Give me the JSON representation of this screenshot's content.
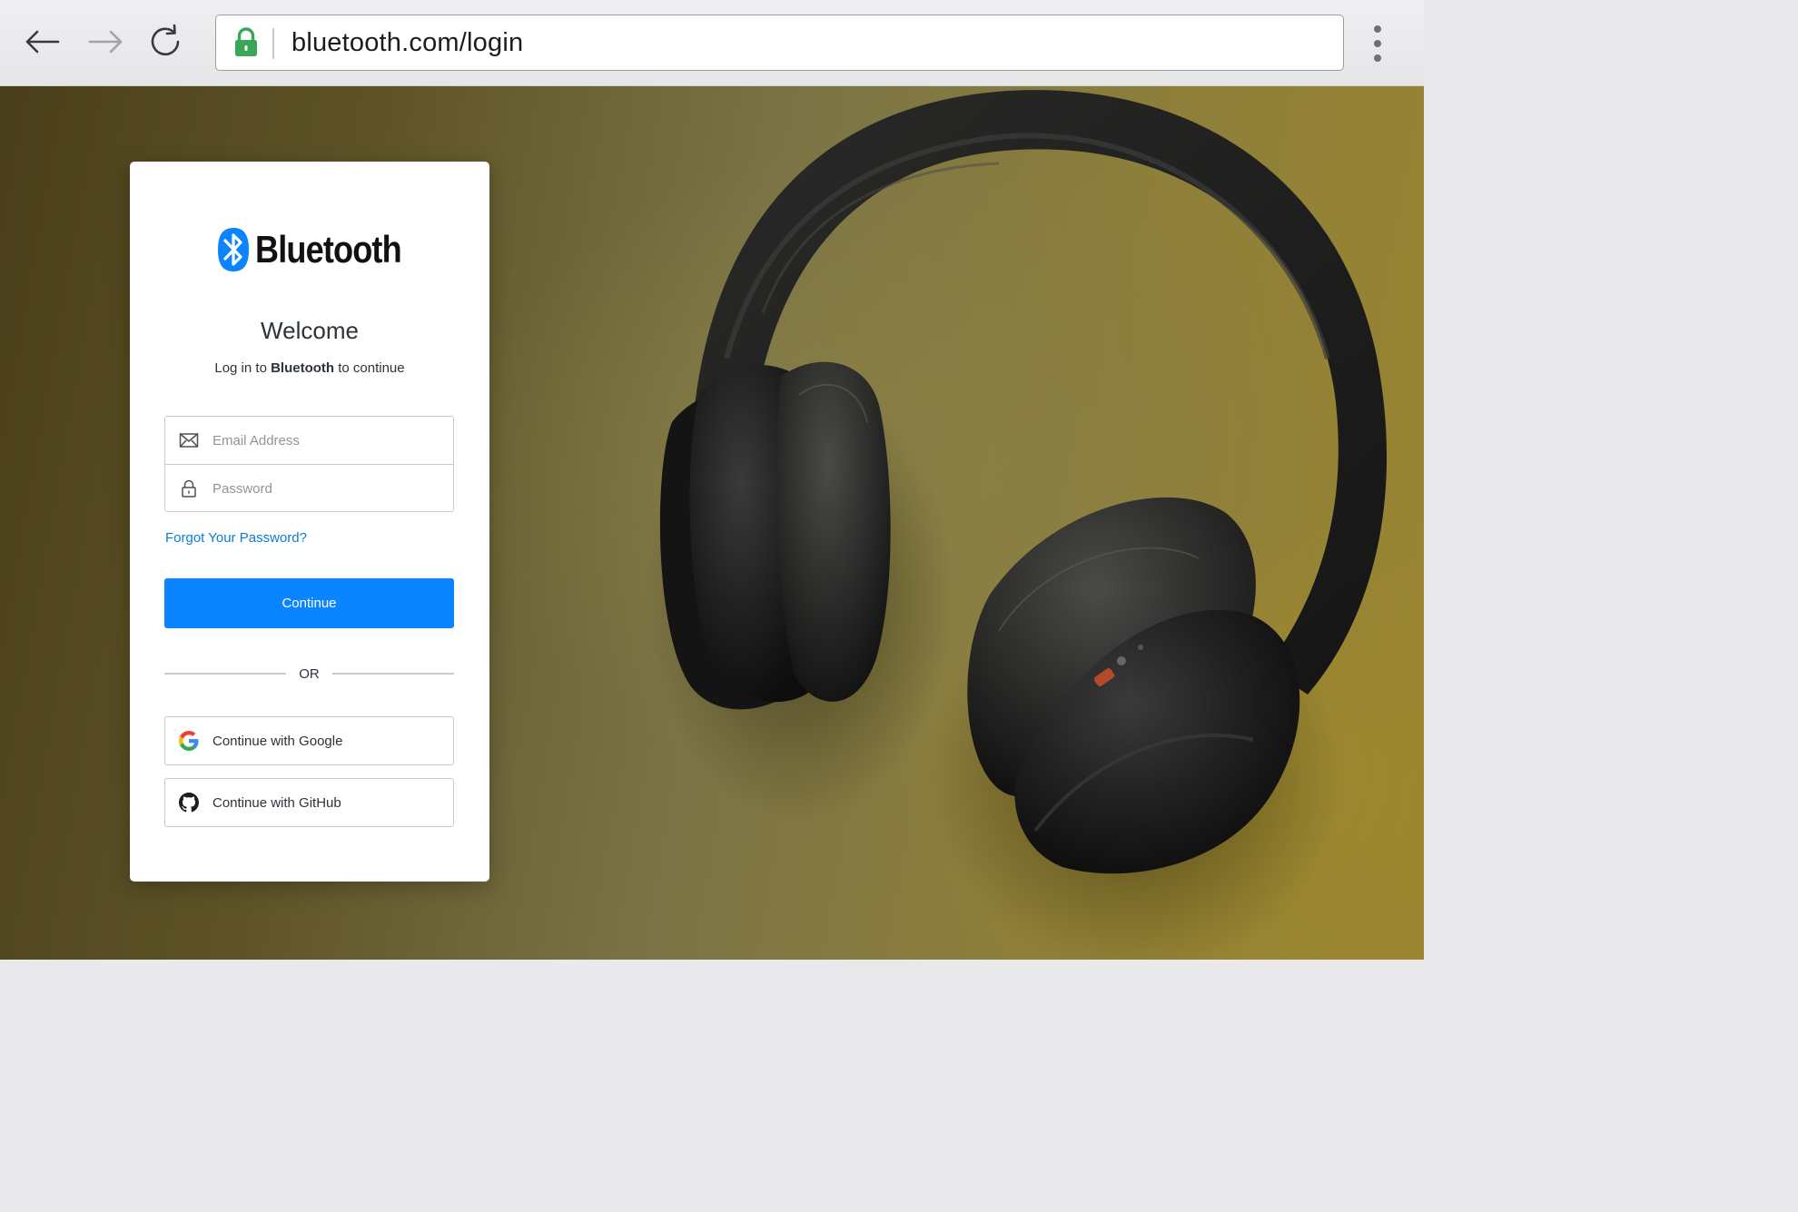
{
  "browser": {
    "url": "bluetooth.com/login",
    "secure": true
  },
  "login": {
    "brand_name": "Bluetooth",
    "welcome": "Welcome",
    "subtitle_prefix": "Log in to ",
    "subtitle_brand": "Bluetooth",
    "subtitle_suffix": " to continue",
    "email_placeholder": "Email Address",
    "password_placeholder": "Password",
    "forgot_link": "Forgot Your Password?",
    "continue_label": "Continue",
    "or_label": "OR",
    "google_label": "Continue with Google",
    "github_label": "Continue with GitHub"
  },
  "colors": {
    "accent": "#0a84ff",
    "link": "#0a7cd9",
    "brand_blue": "#0a84ff",
    "lock_green": "#3aa757"
  },
  "icons": {
    "back": "arrow-left-icon",
    "forward": "arrow-right-icon",
    "reload": "reload-icon",
    "lock": "lock-icon",
    "menu": "kebab-menu-icon",
    "brand": "bluetooth-logo-icon",
    "email": "envelope-icon",
    "password": "padlock-icon",
    "google": "google-logo-icon",
    "github": "github-logo-icon"
  }
}
